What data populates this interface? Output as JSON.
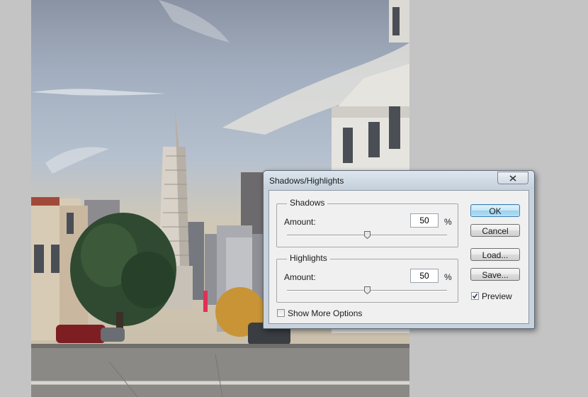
{
  "dialog": {
    "title": "Shadows/Highlights",
    "close_icon": "close-icon"
  },
  "shadows": {
    "group_label": "Shadows",
    "amount_label": "Amount:",
    "amount_value": "50",
    "unit": "%",
    "slider_fraction": 0.5
  },
  "highlights": {
    "group_label": "Highlights",
    "amount_label": "Amount:",
    "amount_value": "50",
    "unit": "%",
    "slider_fraction": 0.5
  },
  "buttons": {
    "ok": "OK",
    "cancel": "Cancel",
    "load": "Load...",
    "save": "Save..."
  },
  "preview": {
    "label": "Preview",
    "checked": true
  },
  "show_more_options": {
    "label": "Show More Options",
    "checked": false
  },
  "colors": {
    "workspace": "#c4c4c4",
    "dialog_frame": "#c9d3de",
    "default_button": "#98d1ef"
  }
}
